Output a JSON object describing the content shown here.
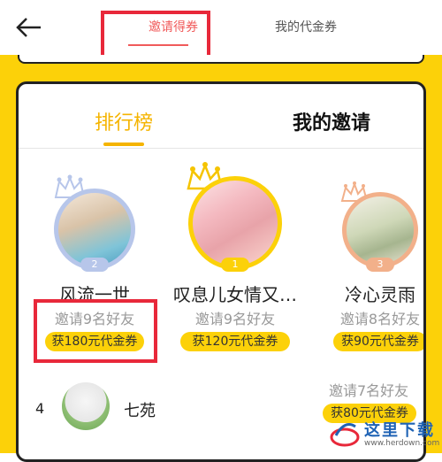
{
  "topbar": {
    "tabs": [
      {
        "label": "邀请得券"
      },
      {
        "label": "我的代金券"
      }
    ]
  },
  "card": {
    "tabs": [
      {
        "label": "排行榜"
      },
      {
        "label": "我的邀请"
      }
    ]
  },
  "podium": [
    {
      "rank": "2",
      "name": "风流一世",
      "invites": "邀请9名好友",
      "reward": "获180元代金券"
    },
    {
      "rank": "1",
      "name": "叹息儿女情又…",
      "invites": "邀请9名好友",
      "reward": "获120元代金券"
    },
    {
      "rank": "3",
      "name": "冷心灵雨",
      "invites": "邀请8名好友",
      "reward": "获90元代金券"
    }
  ],
  "list": [
    {
      "rank": "4",
      "name": "七苑",
      "invites": "邀请7名好友",
      "reward": "获80元代金券"
    }
  ],
  "watermark": {
    "text": "这里下载",
    "sub": "www.herdown.com"
  },
  "colors": {
    "accent_yellow": "#fcd109",
    "accent_red": "#f05a5a",
    "highlight": "#e8283a"
  }
}
